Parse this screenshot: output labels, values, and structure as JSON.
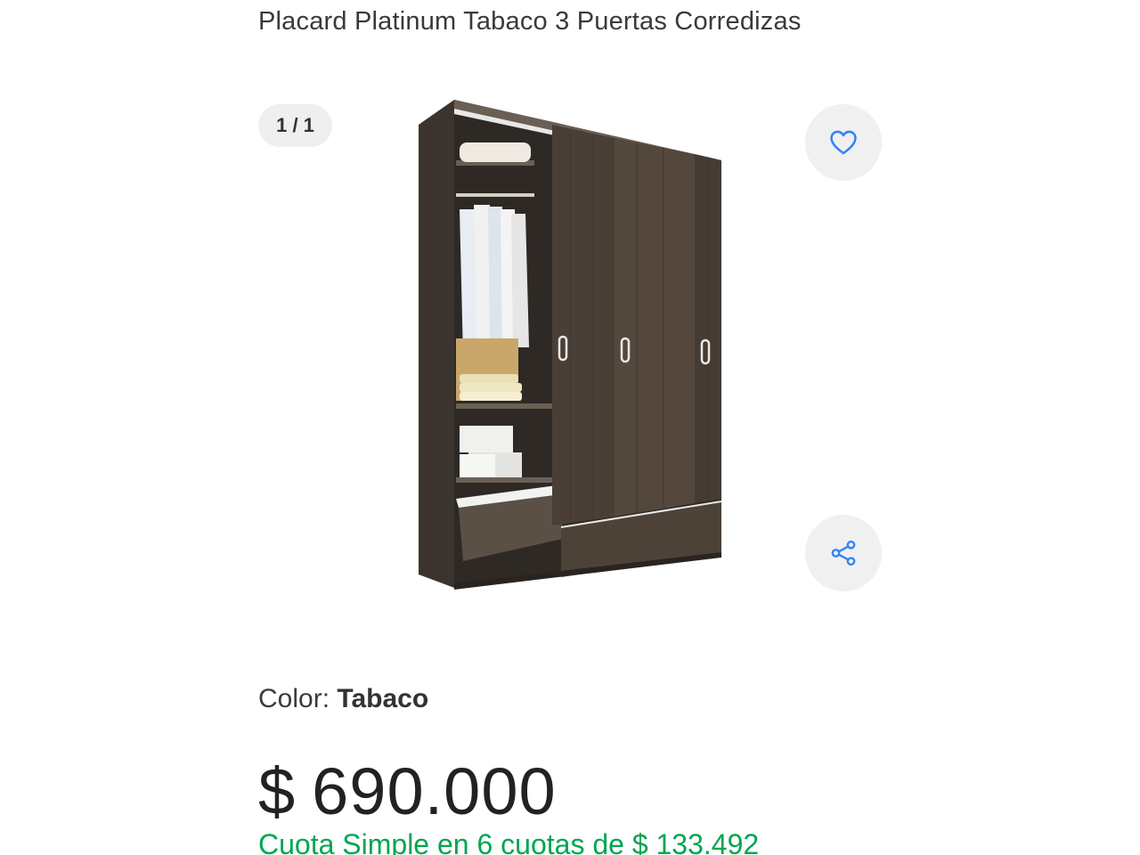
{
  "product": {
    "title": "Placard Platinum Tabaco 3 Puertas Corredizas"
  },
  "gallery": {
    "counter": "1 / 1",
    "favorite_icon": "heart-icon",
    "share_icon": "share-icon"
  },
  "color": {
    "label": "Color: ",
    "value": "Tabaco"
  },
  "price": {
    "currency": "$",
    "amount": "690.000"
  },
  "installments": {
    "text": "Cuota Simple en 6 cuotas de $ 133.492"
  },
  "colors": {
    "accent": "#3483fa",
    "installments": "#00a650",
    "wardrobe": "#4a3f36"
  }
}
